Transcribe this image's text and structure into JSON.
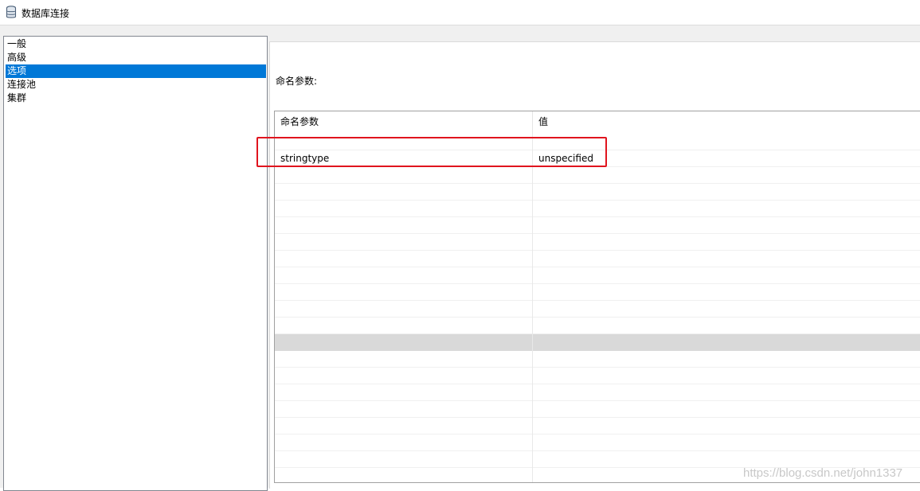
{
  "window": {
    "title": "数据库连接",
    "icon": "database-icon"
  },
  "nav": {
    "items": [
      {
        "label": "一般",
        "selected": false
      },
      {
        "label": "高级",
        "selected": false
      },
      {
        "label": "选项",
        "selected": true
      },
      {
        "label": "连接池",
        "selected": false
      },
      {
        "label": "集群",
        "selected": false
      }
    ]
  },
  "panel": {
    "section_label": "命名参数:",
    "grid": {
      "columns": [
        "命名参数",
        "值"
      ],
      "rows": [
        {
          "name": "stringtype",
          "value": "unspecified"
        }
      ],
      "highlight_row_index": 11
    }
  },
  "watermark": "https://blog.csdn.net/john1337",
  "colors": {
    "selection": "#0078d7",
    "annotation": "#e0141e",
    "row_highlight": "#d9d9d9"
  }
}
